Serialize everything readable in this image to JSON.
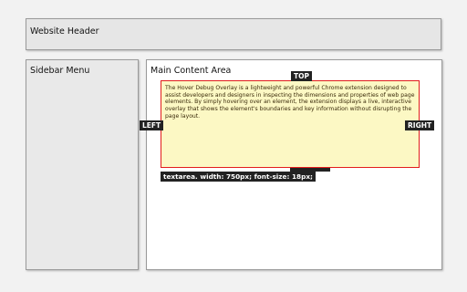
{
  "header": {
    "title": "Website Header"
  },
  "sidebar": {
    "title": "Sidebar Menu"
  },
  "main": {
    "title": "Main Content Area",
    "textarea_text": "The Hover Debug Overlay is a lightweight and powerful Chrome extension designed to assist developers and designers in inspecting the dimensions and properties of web page elements.  By simply hovering over an element, the extension displays a live, interactive overlay that shows the element's boundaries and key information without disrupting the page layout."
  },
  "overlay": {
    "top_label": "TOP",
    "left_label": "LEFT",
    "right_label": "RIGHT",
    "info_label": "textarea. width: 750px; font-size: 18px;",
    "highlight_color": "#e21c1c",
    "tag_bg_color": "#222222"
  }
}
